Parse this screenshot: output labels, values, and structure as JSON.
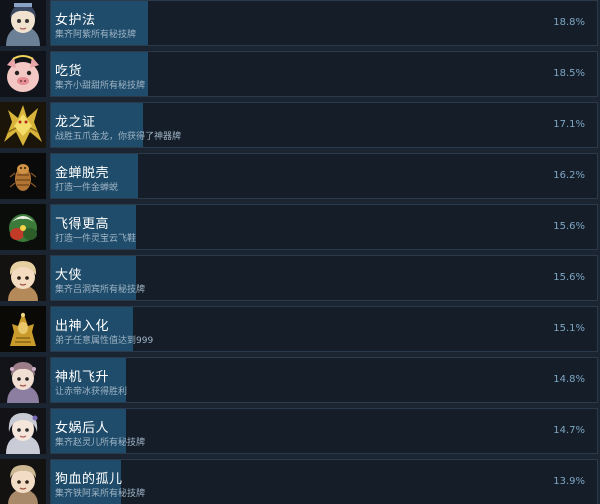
{
  "achievements": [
    {
      "icon": "female-guardian-portrait-icon",
      "title": "女护法",
      "desc": "集齐阿紫所有秘技牌",
      "percent": "18.8%",
      "fill": 0.177
    },
    {
      "icon": "pig-demon-portrait-icon",
      "title": "吃货",
      "desc": "集齐小甜甜所有秘技牌",
      "percent": "18.5%",
      "fill": 0.177
    },
    {
      "icon": "golden-dragon-icon",
      "title": "龙之证",
      "desc": "战胜五爪金龙，你获得了神器牌",
      "percent": "17.1%",
      "fill": 0.169
    },
    {
      "icon": "golden-cicada-shell-icon",
      "title": "金蝉脱壳",
      "desc": "打造一件金蝉蜕",
      "percent": "16.2%",
      "fill": 0.16
    },
    {
      "icon": "flying-cloud-shoes-icon",
      "title": "飞得更高",
      "desc": "打造一件灵宝云飞鞋",
      "percent": "15.6%",
      "fill": 0.155
    },
    {
      "icon": "hero-portrait-icon",
      "title": "大侠",
      "desc": "集齐吕洞宾所有秘技牌",
      "percent": "15.6%",
      "fill": 0.155
    },
    {
      "icon": "golden-idol-icon",
      "title": "出神入化",
      "desc": "弟子任意属性值达到999",
      "percent": "15.1%",
      "fill": 0.15
    },
    {
      "icon": "mechanical-sage-portrait-icon",
      "title": "神机飞升",
      "desc": "让赤帝冰获得胜利",
      "percent": "14.8%",
      "fill": 0.138
    },
    {
      "icon": "nuwa-descendant-portrait-icon",
      "title": "女娲后人",
      "desc": "集齐赵灵儿所有秘技牌",
      "percent": "14.7%",
      "fill": 0.138
    },
    {
      "icon": "bloody-orphan-portrait-icon",
      "title": "狗血的孤儿",
      "desc": "集齐铁阿呆所有秘技牌",
      "percent": "13.9%",
      "fill": 0.128
    }
  ],
  "colors": {
    "background": "#1b2531",
    "row_background": "#141d28",
    "fill": "#1f4c6a",
    "title": "#ffffff",
    "desc": "#9fb4c5",
    "percent": "#7ea7c4"
  }
}
